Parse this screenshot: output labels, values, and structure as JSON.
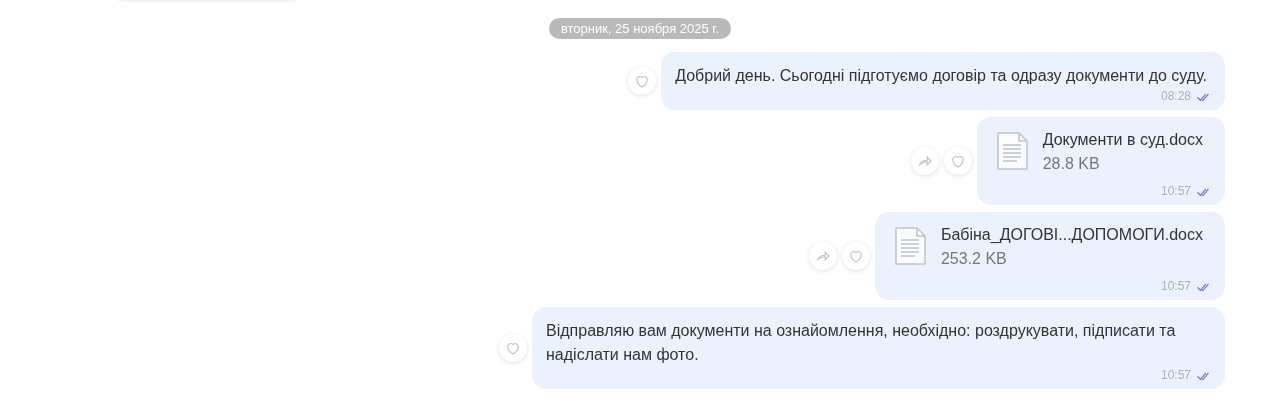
{
  "date_divider": "вторник, 25 ноября 2025 г.",
  "messages": [
    {
      "kind": "text",
      "text": "Добрий день. Сьогодні підготуємо договір та одразу документи до суду.",
      "time": "08:28",
      "read": true,
      "shareable": false
    },
    {
      "kind": "file",
      "file_name": "Документи в суд.docx",
      "file_size": "28.8 KB",
      "time": "10:57",
      "read": true,
      "shareable": true
    },
    {
      "kind": "file",
      "file_name": "Бабіна_ДОГОВІ...ДОПОМОГИ.docx",
      "file_size": "253.2 KB",
      "time": "10:57",
      "read": true,
      "shareable": true
    },
    {
      "kind": "text",
      "text": "Відправляю вам документи на ознайомлення, необхідно: роздрукувати, підписати та надіслати нам фото.",
      "time": "10:57",
      "read": true,
      "shareable": false
    }
  ]
}
